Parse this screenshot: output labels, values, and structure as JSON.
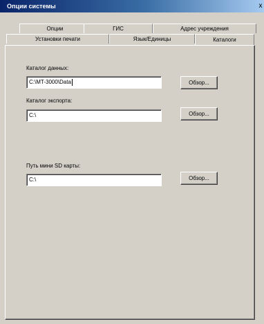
{
  "window": {
    "title": "Опции системы",
    "close_glyph": "x"
  },
  "tabs_row1": [
    {
      "label": "Опции"
    },
    {
      "label": "ГИС"
    },
    {
      "label": "Адрес учреждения"
    }
  ],
  "tabs_row2": [
    {
      "label": "Установки печати"
    },
    {
      "label": "Язык/Единицы"
    },
    {
      "label": "Каталоги",
      "active": true
    }
  ],
  "catalogs": {
    "data_dir": {
      "label": "Каталог данных:",
      "value": "C:\\MT-3000\\Data",
      "browse": "Обзор..."
    },
    "export_dir": {
      "label": "Каталог экспорта:",
      "value": "C:\\",
      "browse": "Обзор..."
    },
    "sd_card_path": {
      "label": "Путь мини SD карты:",
      "value": "C:\\",
      "browse": "Обзор..."
    }
  }
}
